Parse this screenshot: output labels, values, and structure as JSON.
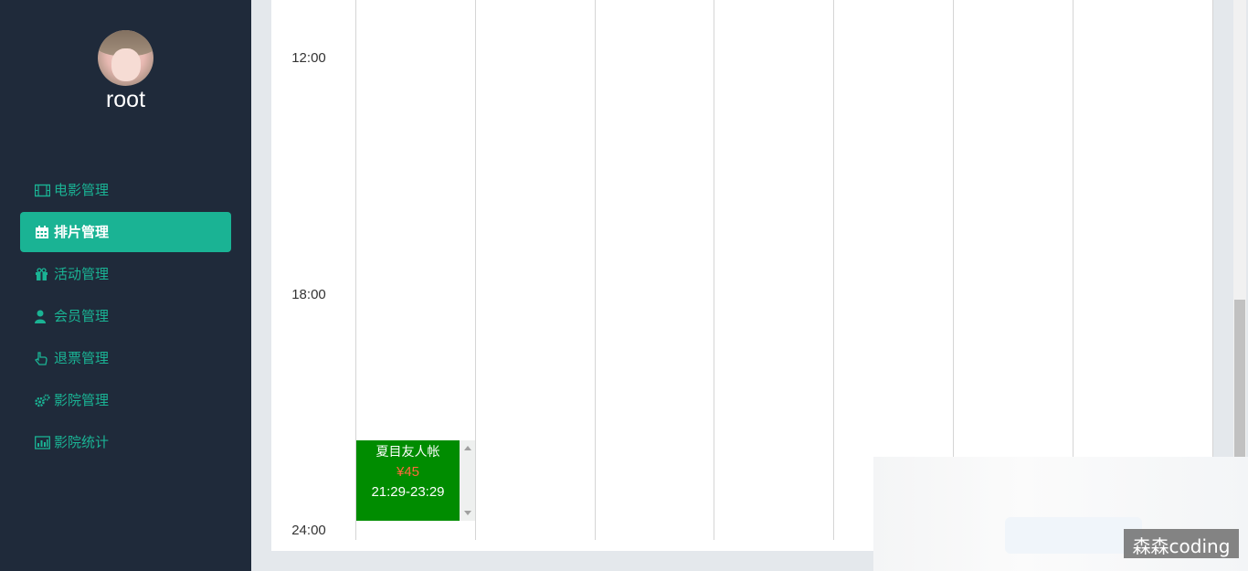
{
  "user": {
    "name": "root"
  },
  "menu": [
    {
      "label": "电影管理",
      "icon": "film-icon",
      "active": false
    },
    {
      "label": "排片管理",
      "icon": "calendar-icon",
      "active": true
    },
    {
      "label": "活动管理",
      "icon": "gift-icon",
      "active": false
    },
    {
      "label": "会员管理",
      "icon": "user-icon",
      "active": false
    },
    {
      "label": "退票管理",
      "icon": "hand-pointer-icon",
      "active": false
    },
    {
      "label": "影院管理",
      "icon": "gears-icon",
      "active": false
    },
    {
      "label": "影院统计",
      "icon": "bar-chart-icon",
      "active": false
    }
  ],
  "schedule": {
    "time_labels": [
      "12:00",
      "18:00",
      "24:00"
    ],
    "events": [
      {
        "title": "夏目友人帐",
        "price": "¥45",
        "time": "21:29-23:29"
      }
    ]
  },
  "watermark": "森森coding",
  "colors": {
    "sidebar": "#1f2a3a",
    "accent": "#1ab394",
    "event": "#008c00",
    "price": "#ff6a3c"
  }
}
